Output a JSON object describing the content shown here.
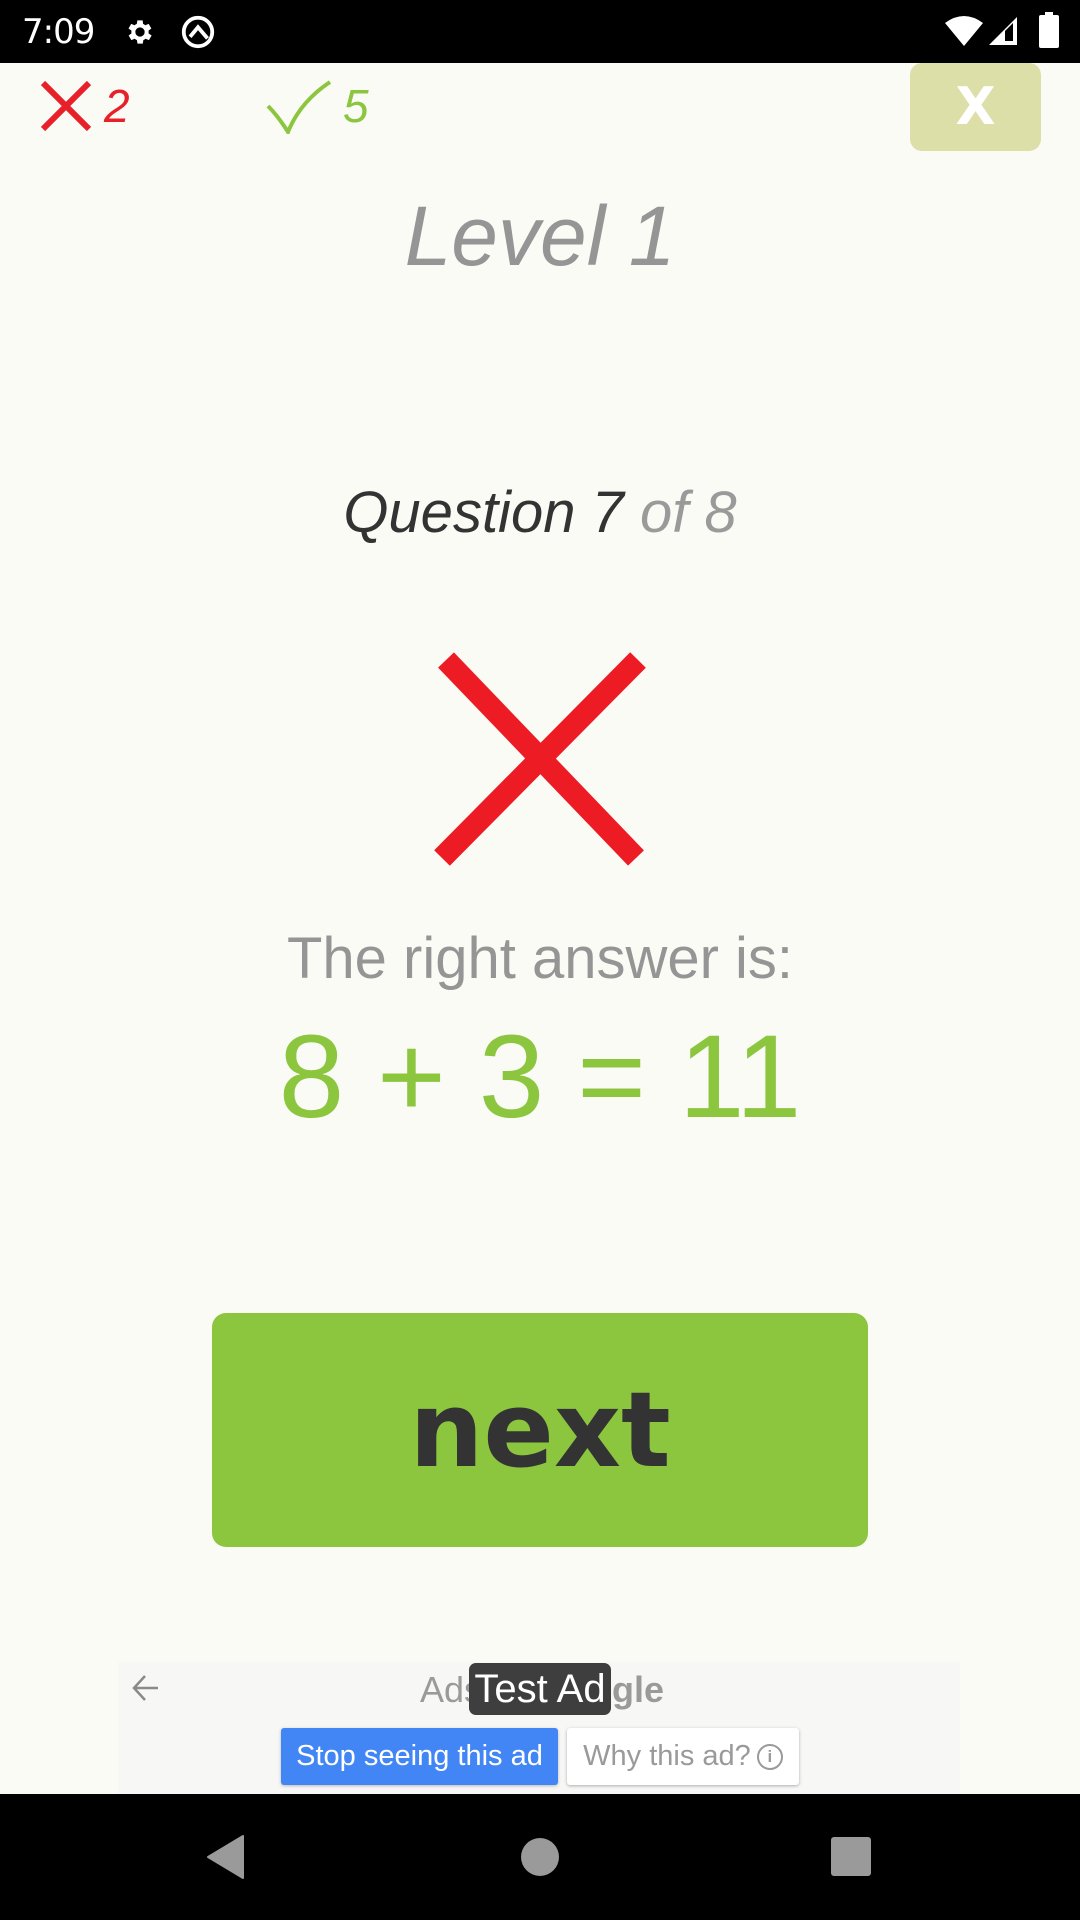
{
  "status_bar": {
    "time": "7:09",
    "left_icons": [
      "gear-icon",
      "q-logo-icon"
    ],
    "right_icons": [
      "wifi-icon",
      "signal-icon",
      "battery-icon"
    ]
  },
  "score": {
    "wrong_count": "2",
    "right_count": "5",
    "wrong_color": "#E8202A",
    "right_color": "#8CC63F"
  },
  "close_button": {
    "label": "X",
    "color": "#DCDFA8"
  },
  "level": {
    "title": "Level 1"
  },
  "question": {
    "prefix": "Question 7",
    "suffix": " of 8",
    "current": 7,
    "total": 8
  },
  "result": {
    "icon": "wrong-x-icon",
    "color": "#ED1C24"
  },
  "answer": {
    "label": "The right answer is:",
    "equation": "8 + 3 = 11",
    "color": "#8CC63F"
  },
  "next_button": {
    "label": "next",
    "color": "#8CC63F"
  },
  "ad": {
    "attribution_prefix": "Ads",
    "attribution_suffix": "gle",
    "badge": "Test Ad",
    "stop_label": "Stop seeing this ad",
    "why_label": "Why this ad?",
    "why_icon": "i",
    "stop_color": "#4285F4"
  },
  "nav_bar": {
    "buttons": [
      "back",
      "home",
      "recents"
    ]
  }
}
